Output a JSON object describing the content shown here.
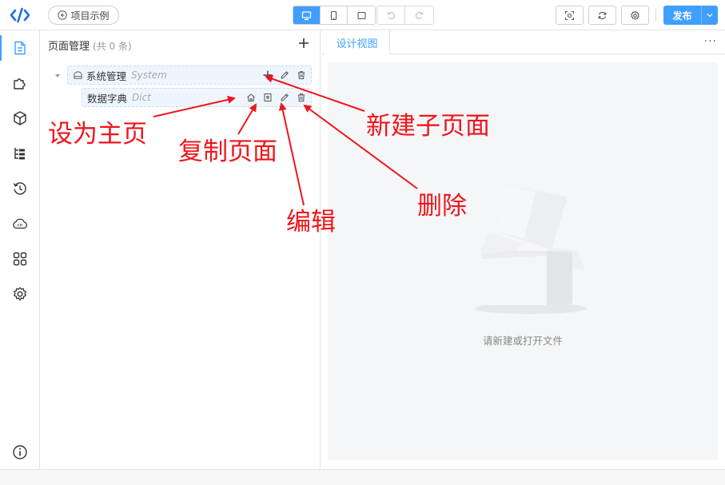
{
  "header": {
    "back_label": "项目示例",
    "publish_label": "发布",
    "devices": [
      "desktop-icon",
      "mobile-icon",
      "tablet-icon"
    ],
    "active_device": "desktop-icon"
  },
  "sidebar": {
    "items": [
      "pages-icon",
      "plugin-icon",
      "cube-icon",
      "tree-list-icon",
      "history-icon",
      "api-cloud-icon",
      "apps-grid-icon",
      "settings-icon",
      "info-icon"
    ],
    "active": "pages-icon"
  },
  "panel": {
    "title": "页面管理",
    "count": "(共 0 条)",
    "tree": [
      {
        "label": "系统管理",
        "sub": "System"
      },
      {
        "label": "数据字典",
        "sub": "Dict"
      }
    ]
  },
  "view": {
    "tab_label": "设计视图",
    "empty_text": "请新建或打开文件"
  },
  "annotations": {
    "set_home": "设为主页",
    "copy_page": "复制页面",
    "edit": "编辑",
    "new_child": "新建子页面",
    "delete": "删除"
  },
  "colors": {
    "accent": "#409eff",
    "annotation": "#f0151b"
  }
}
